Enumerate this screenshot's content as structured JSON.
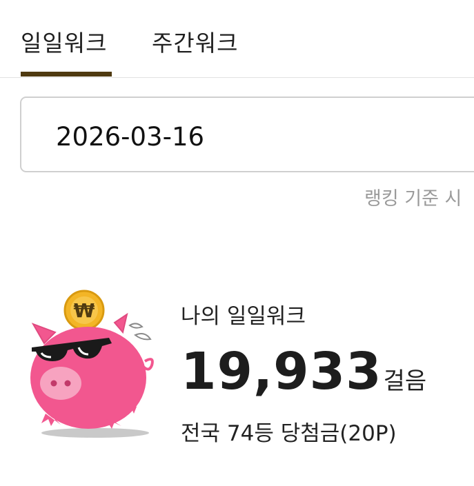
{
  "tabs": [
    {
      "label": "일일워크",
      "active": true
    },
    {
      "label": "주간워크",
      "active": false
    }
  ],
  "date_field": {
    "value": "2026-03-16"
  },
  "ranking_note": "랭킹 기준 시",
  "summary": {
    "label": "나의 일일워크",
    "steps": "19,933",
    "steps_unit": "걸음",
    "rank_line": "전국 74등 당첨금(20P)"
  },
  "illustration": {
    "coin_symbol": "₩",
    "colors": {
      "pig": "#f2578f",
      "coin": "#f3b526",
      "accent": "#4f3a10"
    }
  }
}
